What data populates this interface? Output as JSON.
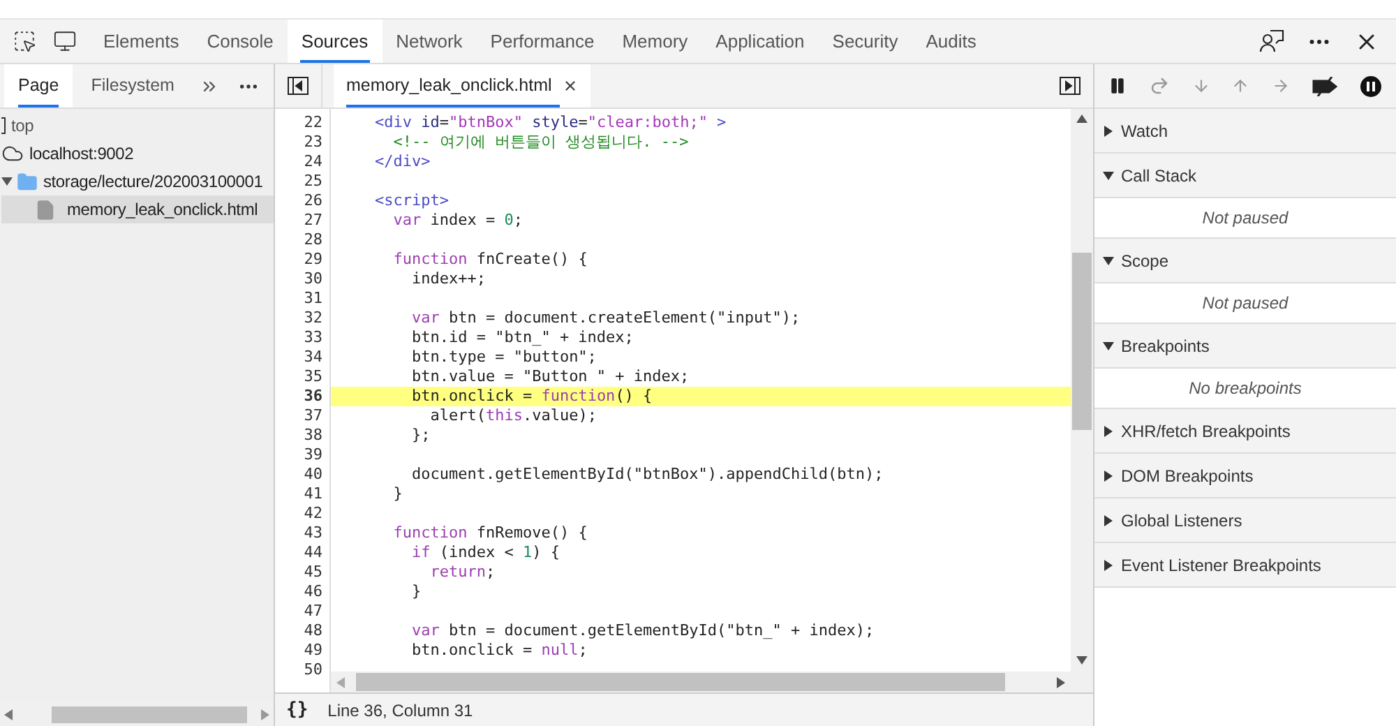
{
  "main_tabs": [
    {
      "label": "Elements",
      "selected": false
    },
    {
      "label": "Console",
      "selected": false
    },
    {
      "label": "Sources",
      "selected": true
    },
    {
      "label": "Network",
      "selected": false
    },
    {
      "label": "Performance",
      "selected": false
    },
    {
      "label": "Memory",
      "selected": false
    },
    {
      "label": "Application",
      "selected": false
    },
    {
      "label": "Security",
      "selected": false
    },
    {
      "label": "Audits",
      "selected": false
    }
  ],
  "navigator": {
    "tabs": [
      {
        "label": "Page",
        "selected": true
      },
      {
        "label": "Filesystem",
        "selected": false
      }
    ],
    "tree": [
      {
        "label": "top",
        "kind": "frame",
        "selected": false,
        "children": [
          {
            "label": "localhost:9002",
            "kind": "host",
            "selected": false,
            "children": [
              {
                "label": "storage/lecture/202003100001",
                "kind": "folder",
                "selected": false,
                "expanded": true,
                "children": [
                  {
                    "label": "memory_leak_onclick.html",
                    "kind": "file",
                    "selected": true
                  }
                ]
              }
            ]
          }
        ]
      }
    ]
  },
  "editor": {
    "tab": {
      "label": "memory_leak_onclick.html",
      "selected": true
    },
    "lines": [
      {
        "num": "22",
        "highlighted": false,
        "tokens": [
          {
            "kind": "tag",
            "text": "    <div"
          },
          {
            "kind": "attr",
            "text": " id"
          },
          {
            "kind": "plain",
            "text": "="
          },
          {
            "kind": "value",
            "text": "\"btnBox\""
          },
          {
            "kind": "attr",
            "text": " style"
          },
          {
            "kind": "plain",
            "text": "="
          },
          {
            "kind": "value",
            "text": "\"clear:both;\""
          },
          {
            "kind": "tag",
            "text": " >"
          }
        ]
      },
      {
        "num": "23",
        "highlighted": false,
        "tokens": [
          {
            "kind": "comment",
            "text": "      <!-- 여기에 버튼들이 생성됩니다. -->"
          }
        ]
      },
      {
        "num": "24",
        "highlighted": false,
        "tokens": [
          {
            "kind": "tag",
            "text": "    </div>"
          }
        ]
      },
      {
        "num": "25",
        "highlighted": false
      },
      {
        "num": "26",
        "highlighted": false,
        "tokens": [
          {
            "kind": "tag",
            "text": "    <script>"
          }
        ]
      },
      {
        "num": "27",
        "highlighted": false,
        "tokens": [
          {
            "kind": "keyword",
            "text": "      var"
          },
          {
            "kind": "plain",
            "text": " index = "
          },
          {
            "kind": "number",
            "text": "0"
          },
          {
            "kind": "plain",
            "text": ";"
          }
        ]
      },
      {
        "num": "28",
        "highlighted": false
      },
      {
        "num": "29",
        "highlighted": false,
        "tokens": [
          {
            "kind": "keyword",
            "text": "      function"
          },
          {
            "kind": "plain",
            "text": " fnCreate() {"
          }
        ]
      },
      {
        "num": "30",
        "highlighted": false,
        "tokens": [
          {
            "kind": "plain",
            "text": "        index++;"
          }
        ]
      },
      {
        "num": "31",
        "highlighted": false
      },
      {
        "num": "32",
        "highlighted": false,
        "tokens": [
          {
            "kind": "keyword",
            "text": "        var"
          },
          {
            "kind": "plain",
            "text": " btn = document.createElement(\"input\");"
          }
        ]
      },
      {
        "num": "33",
        "highlighted": false,
        "tokens": [
          {
            "kind": "plain",
            "text": "        btn.id = \"btn_\" + index;"
          }
        ]
      },
      {
        "num": "34",
        "highlighted": false,
        "tokens": [
          {
            "kind": "plain",
            "text": "        btn.type = \"button\";"
          }
        ]
      },
      {
        "num": "35",
        "highlighted": false,
        "tokens": [
          {
            "kind": "plain",
            "text": "        btn.value = \"Button \" + index;"
          }
        ]
      },
      {
        "num": "36",
        "highlighted": true,
        "tokens": [
          {
            "kind": "plain",
            "text": "        btn.onclick = "
          },
          {
            "kind": "keyword",
            "text": "function"
          },
          {
            "kind": "plain",
            "text": "() {"
          }
        ]
      },
      {
        "num": "37",
        "highlighted": false,
        "tokens": [
          {
            "kind": "plain",
            "text": "          alert("
          },
          {
            "kind": "keyword",
            "text": "this"
          },
          {
            "kind": "plain",
            "text": ".value);"
          }
        ]
      },
      {
        "num": "38",
        "highlighted": false,
        "tokens": [
          {
            "kind": "plain",
            "text": "        };"
          }
        ]
      },
      {
        "num": "39",
        "highlighted": false
      },
      {
        "num": "40",
        "highlighted": false,
        "tokens": [
          {
            "kind": "plain",
            "text": "        document.getElementById(\"btnBox\").appendChild(btn);"
          }
        ]
      },
      {
        "num": "41",
        "highlighted": false,
        "tokens": [
          {
            "kind": "plain",
            "text": "      }"
          }
        ]
      },
      {
        "num": "42",
        "highlighted": false
      },
      {
        "num": "43",
        "highlighted": false,
        "tokens": [
          {
            "kind": "keyword",
            "text": "      function"
          },
          {
            "kind": "plain",
            "text": " fnRemove() {"
          }
        ]
      },
      {
        "num": "44",
        "highlighted": false,
        "tokens": [
          {
            "kind": "keyword",
            "text": "        if"
          },
          {
            "kind": "plain",
            "text": " (index < "
          },
          {
            "kind": "number",
            "text": "1"
          },
          {
            "kind": "plain",
            "text": ") {"
          }
        ]
      },
      {
        "num": "45",
        "highlighted": false,
        "tokens": [
          {
            "kind": "keyword",
            "text": "          return"
          },
          {
            "kind": "plain",
            "text": ";"
          }
        ]
      },
      {
        "num": "46",
        "highlighted": false,
        "tokens": [
          {
            "kind": "plain",
            "text": "        }"
          }
        ]
      },
      {
        "num": "47",
        "highlighted": false
      },
      {
        "num": "48",
        "highlighted": false,
        "tokens": [
          {
            "kind": "keyword",
            "text": "        var"
          },
          {
            "kind": "plain",
            "text": " btn = document.getElementById(\"btn_\" + index);"
          }
        ]
      },
      {
        "num": "49",
        "highlighted": false,
        "tokens": [
          {
            "kind": "plain",
            "text": "        btn.onclick = "
          },
          {
            "kind": "keyword",
            "text": "null"
          },
          {
            "kind": "plain",
            "text": ";"
          }
        ]
      },
      {
        "num": "50",
        "highlighted": false
      }
    ],
    "pretty_print": "{}",
    "status": "Line 36, Column 31"
  },
  "debugger": {
    "sections": [
      {
        "title": "Watch",
        "expanded": false
      },
      {
        "title": "Call Stack",
        "expanded": true,
        "message": "Not paused"
      },
      {
        "title": "Scope",
        "expanded": true,
        "message": "Not paused"
      },
      {
        "title": "Breakpoints",
        "expanded": true,
        "message": "No breakpoints"
      },
      {
        "title": "XHR/fetch Breakpoints",
        "expanded": false
      },
      {
        "title": "DOM Breakpoints",
        "expanded": false
      },
      {
        "title": "Global Listeners",
        "expanded": false
      },
      {
        "title": "Event Listener Breakpoints",
        "expanded": false
      }
    ]
  }
}
